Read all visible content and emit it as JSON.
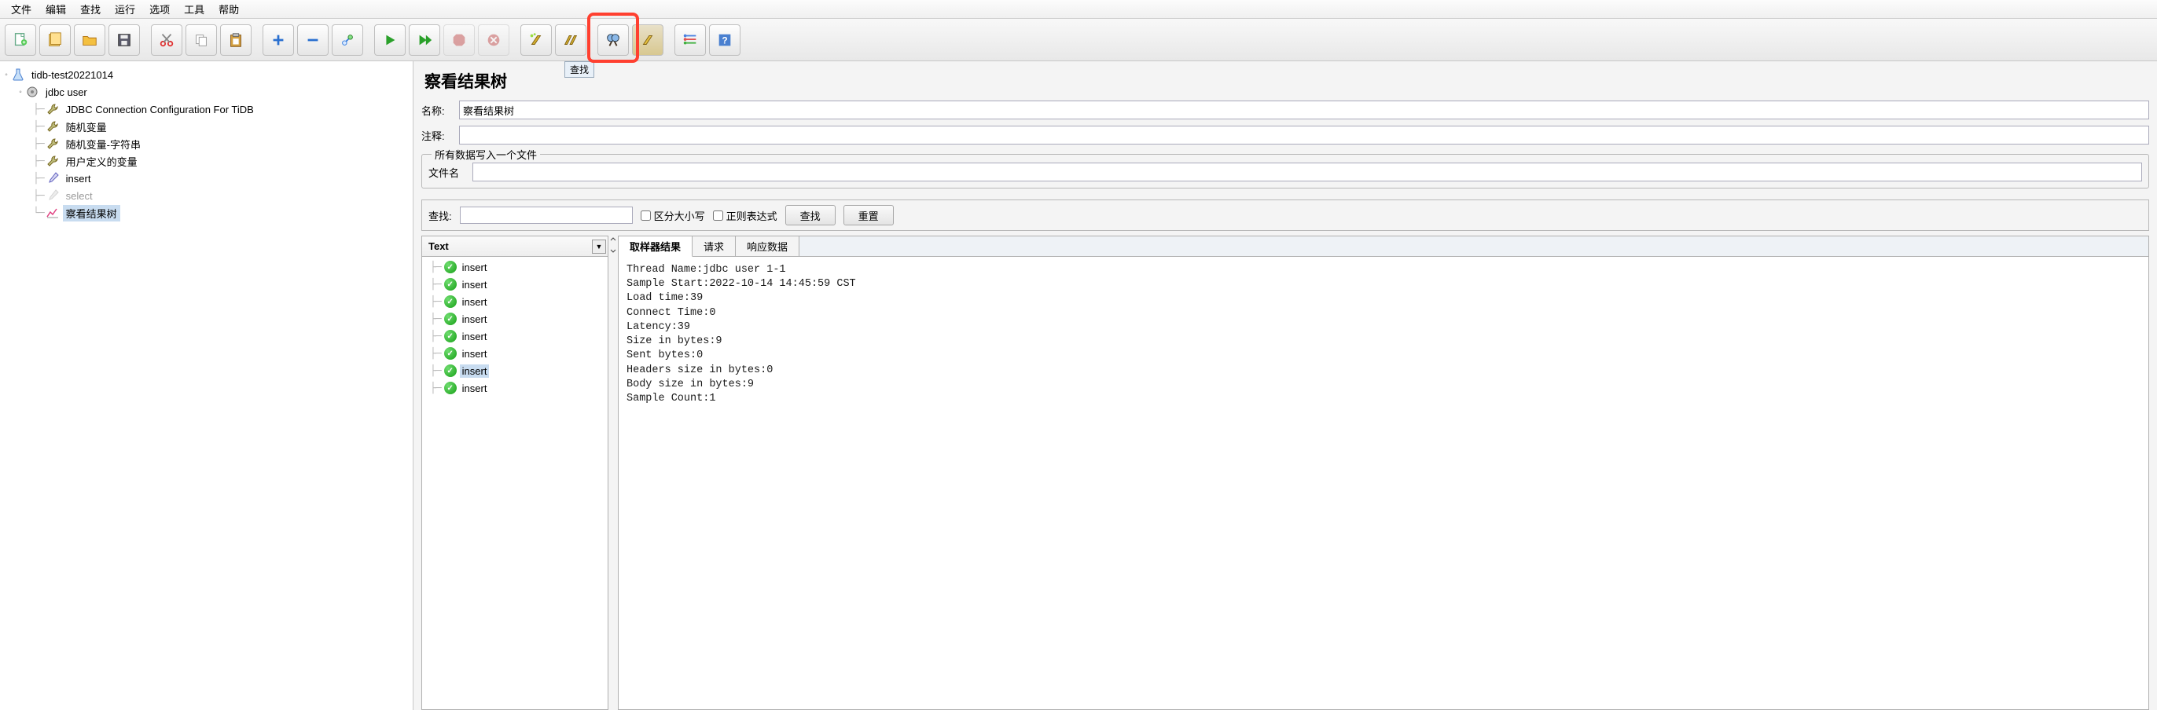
{
  "menu": [
    "文件",
    "编辑",
    "查找",
    "运行",
    "选项",
    "工具",
    "帮助"
  ],
  "toolbar_tooltip_find": "查找",
  "tree": {
    "root": "tidb-test20221014",
    "thread_group": "jdbc user",
    "items": [
      "JDBC Connection Configuration For TiDB",
      "随机变量",
      "随机变量-字符串",
      "用户定义的变量",
      "insert",
      "select",
      "察看结果树"
    ],
    "selected_index": 6,
    "muted_index": 5
  },
  "panel": {
    "title": "察看结果树",
    "name_label": "名称:",
    "name_value": "察看结果树",
    "comment_label": "注释:",
    "comment_value": "",
    "file_fieldset_legend": "所有数据写入一个文件",
    "file_label": "文件名",
    "file_value": ""
  },
  "search": {
    "label": "查找:",
    "value": "",
    "case_label": "区分大小写",
    "regex_label": "正则表达式",
    "find_btn": "查找",
    "reset_btn": "重置"
  },
  "results": {
    "renderer": "Text",
    "samples": [
      "insert",
      "insert",
      "insert",
      "insert",
      "insert",
      "insert",
      "insert",
      "insert"
    ],
    "selected_sample": 6,
    "tabs": [
      "取样器结果",
      "请求",
      "响应数据"
    ],
    "active_tab": 0,
    "detail_lines": [
      "Thread Name:jdbc user 1-1",
      "Sample Start:2022-10-14 14:45:59 CST",
      "Load time:39",
      "Connect Time:0",
      "Latency:39",
      "Size in bytes:9",
      "Sent bytes:0",
      "Headers size in bytes:0",
      "Body size in bytes:9",
      "Sample Count:1"
    ]
  }
}
